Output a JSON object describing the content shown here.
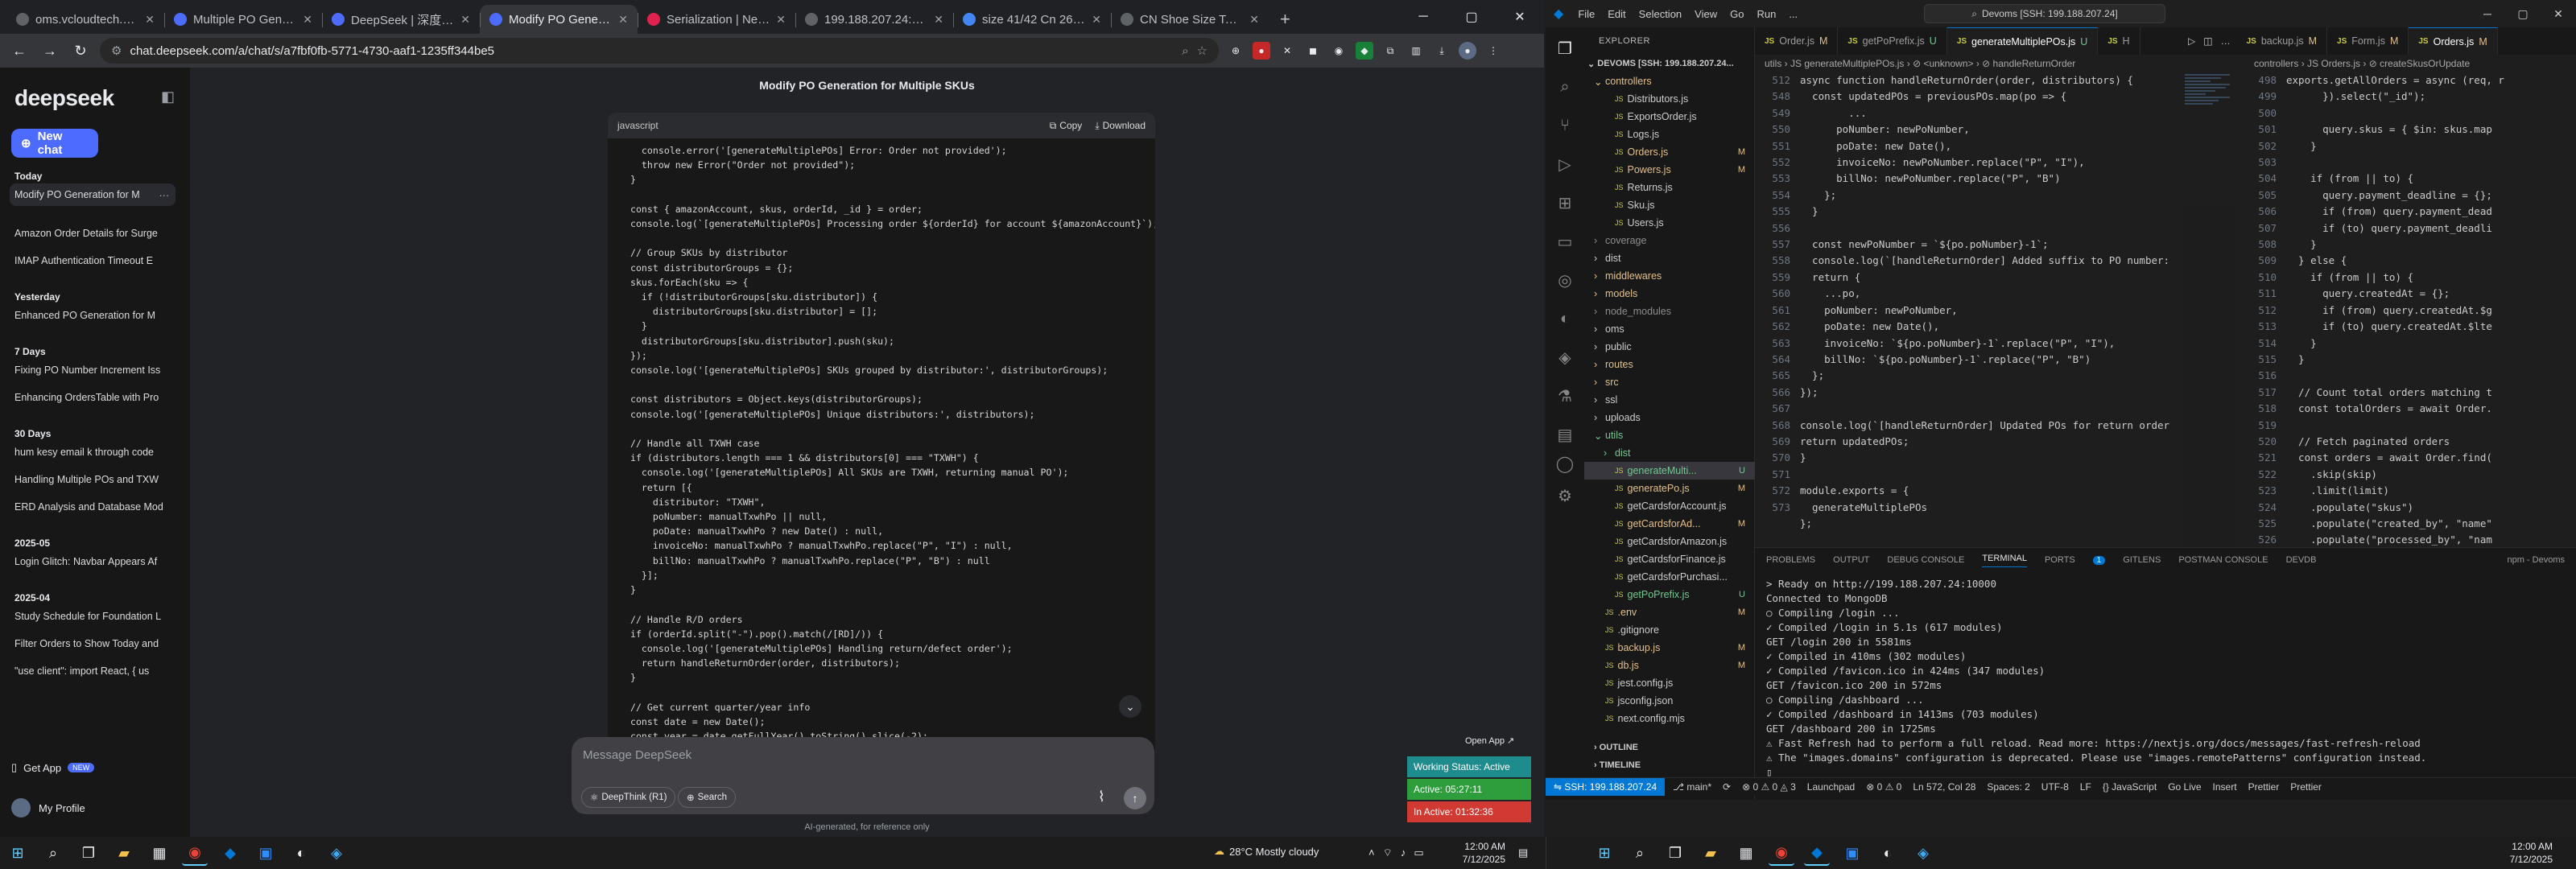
{
  "browser": {
    "tabs": [
      {
        "title": "oms.vcloudtech.org/das",
        "fav": "#5f6368"
      },
      {
        "title": "Multiple PO Generation",
        "fav": "#4d6bfe"
      },
      {
        "title": "DeepSeek | 深度求索",
        "fav": "#4d6bfe"
      },
      {
        "title": "Modify PO Generation fo",
        "fav": "#4d6bfe"
      },
      {
        "title": "Serialization | NestJS - A",
        "fav": "#e0234e"
      },
      {
        "title": "199.188.207.24:10000/da",
        "fav": "#5f6368"
      },
      {
        "title": "size 41/42 Cn 26.5 - Goo",
        "fav": "#4285f4"
      },
      {
        "title": "CN Shoe Size To US - A",
        "fav": "#5f6368"
      }
    ],
    "new_tab": "+",
    "url": "chat.deepseek.com/a/chat/s/a7fbf0fb-5771-4730-aaf1-1235ff344be5"
  },
  "deepseek": {
    "logo": "deepseek",
    "new_chat": "New chat",
    "groups": [
      {
        "label": "Today",
        "items": [
          "Modify PO Generation for M"
        ]
      },
      {
        "label": "",
        "items": [
          "Amazon Order Details for Surge",
          "IMAP Authentication Timeout E"
        ]
      },
      {
        "label": "Yesterday",
        "items": [
          "Enhanced PO Generation for M"
        ]
      },
      {
        "label": "7 Days",
        "items": [
          "Fixing PO Number Increment Iss",
          "Enhancing OrdersTable with Pro"
        ]
      },
      {
        "label": "30 Days",
        "items": [
          "hum kesy email k through code",
          "Handling Multiple POs and TXW",
          "ERD Analysis and Database Mod"
        ]
      },
      {
        "label": "2025-05",
        "items": [
          "Login Glitch: Navbar Appears Af"
        ]
      },
      {
        "label": "2025-04",
        "items": [
          "Study Schedule for Foundation L",
          "Filter Orders to Show Today and",
          "\"use client\": import React, { us"
        ]
      }
    ],
    "get_app": "Get App",
    "get_app_badge": "NEW",
    "profile": "My Profile",
    "chat_title": "Modify PO Generation for Multiple SKUs",
    "code_lang": "javascript",
    "copy": "Copy",
    "download": "Download",
    "code": "    console.error('[generateMultiplePOs] Error: Order not provided');\n    throw new Error(\"Order not provided\");\n  }\n\n  const { amazonAccount, skus, orderId, _id } = order;\n  console.log(`[generateMultiplePOs] Processing order ${orderId} for account ${amazonAccount}`);\n\n  // Group SKUs by distributor\n  const distributorGroups = {};\n  skus.forEach(sku => {\n    if (!distributorGroups[sku.distributor]) {\n      distributorGroups[sku.distributor] = [];\n    }\n    distributorGroups[sku.distributor].push(sku);\n  });\n  console.log('[generateMultiplePOs] SKUs grouped by distributor:', distributorGroups);\n\n  const distributors = Object.keys(distributorGroups);\n  console.log('[generateMultiplePOs] Unique distributors:', distributors);\n\n  // Handle all TXWH case\n  if (distributors.length === 1 && distributors[0] === \"TXWH\") {\n    console.log('[generateMultiplePOs] All SKUs are TXWH, returning manual PO');\n    return [{\n      distributor: \"TXWH\",\n      poNumber: manualTxwhPo || null,\n      poDate: manualTxwhPo ? new Date() : null,\n      invoiceNo: manualTxwhPo ? manualTxwhPo.replace(\"P\", \"I\") : null,\n      billNo: manualTxwhPo ? manualTxwhPo.replace(\"P\", \"B\") : null\n    }];\n  }\n\n  // Handle R/D orders\n  if (orderId.split(\"-\").pop().match(/[RD]/)) {\n    console.log('[generateMultiplePOs] Handling return/defect order');\n    return handleReturnOrder(order, distributors);\n  }\n\n  // Get current quarter/year info\n  const date = new Date();\n  const year = date.getFullYear().toString().slice(-2);",
    "input_placeholder": "Message DeepSeek",
    "deepthink": "DeepThink (R1)",
    "search": "Search",
    "footer": "AI-generated, for reference only",
    "open_app": "Open App ↗",
    "status_working": "Working Status: Active",
    "status_active": "Active: 05:27:11",
    "status_inactive": "In Active: 01:32:36",
    "colors": {
      "accent": "#4d6bfe",
      "status_teal": "#1e8c8c",
      "status_green": "#2e9e3c",
      "status_red": "#d13a32"
    }
  },
  "vscode": {
    "menu": [
      "File",
      "Edit",
      "Selection",
      "View",
      "Go",
      "Run",
      "..."
    ],
    "search": "Devoms [SSH: 199.188.207.24]",
    "explorer_title": "EXPLORER",
    "root": "DEVOMS [SSH: 199.188.207.24...",
    "tree": [
      {
        "name": "controllers",
        "depth": 1,
        "folder": true,
        "open": true,
        "badge": "",
        "color": "#e2c08d"
      },
      {
        "name": "Distributors.js",
        "depth": 2,
        "badge": "",
        "color": "#cccccc"
      },
      {
        "name": "ExportsOrder.js",
        "depth": 2,
        "badge": "",
        "color": "#cccccc"
      },
      {
        "name": "Logs.js",
        "depth": 2,
        "badge": "",
        "color": "#cccccc"
      },
      {
        "name": "Orders.js",
        "depth": 2,
        "badge": "M",
        "color": "#e2c08d"
      },
      {
        "name": "Powers.js",
        "depth": 2,
        "badge": "M",
        "color": "#e2c08d"
      },
      {
        "name": "Returns.js",
        "depth": 2,
        "badge": "",
        "color": "#cccccc"
      },
      {
        "name": "Sku.js",
        "depth": 2,
        "badge": "",
        "color": "#cccccc"
      },
      {
        "name": "Users.js",
        "depth": 2,
        "badge": "",
        "color": "#cccccc"
      },
      {
        "name": "coverage",
        "depth": 1,
        "folder": true,
        "badge": "",
        "color": "#8c8c8c"
      },
      {
        "name": "dist",
        "depth": 1,
        "folder": true,
        "badge": "",
        "color": "#cccccc"
      },
      {
        "name": "middlewares",
        "depth": 1,
        "folder": true,
        "badge": "",
        "color": "#e2c08d"
      },
      {
        "name": "models",
        "depth": 1,
        "folder": true,
        "badge": "",
        "color": "#e2c08d"
      },
      {
        "name": "node_modules",
        "depth": 1,
        "folder": true,
        "badge": "",
        "color": "#8c8c8c"
      },
      {
        "name": "oms",
        "depth": 1,
        "folder": true,
        "badge": "",
        "color": "#cccccc"
      },
      {
        "name": "public",
        "depth": 1,
        "folder": true,
        "badge": "",
        "color": "#cccccc"
      },
      {
        "name": "routes",
        "depth": 1,
        "folder": true,
        "badge": "",
        "color": "#e2c08d"
      },
      {
        "name": "src",
        "depth": 1,
        "folder": true,
        "badge": "",
        "color": "#e2c08d"
      },
      {
        "name": "ssl",
        "depth": 1,
        "folder": true,
        "badge": "",
        "color": "#cccccc"
      },
      {
        "name": "uploads",
        "depth": 1,
        "folder": true,
        "badge": "",
        "color": "#cccccc"
      },
      {
        "name": "utils",
        "depth": 1,
        "folder": true,
        "open": true,
        "badge": "",
        "color": "#73c991"
      },
      {
        "name": "dist",
        "depth": 2,
        "folder": true,
        "badge": "",
        "color": "#73c991"
      },
      {
        "name": "generateMulti...",
        "depth": 2,
        "badge": "U",
        "color": "#73c991",
        "sel": true
      },
      {
        "name": "generatePo.js",
        "depth": 2,
        "badge": "M",
        "color": "#e2c08d"
      },
      {
        "name": "getCardsforAccount.js",
        "depth": 2,
        "badge": "",
        "color": "#cccccc"
      },
      {
        "name": "getCardsforAd...",
        "depth": 2,
        "badge": "M",
        "color": "#e2c08d"
      },
      {
        "name": "getCardsforAmazon.js",
        "depth": 2,
        "badge": "",
        "color": "#cccccc"
      },
      {
        "name": "getCardsforFinance.js",
        "depth": 2,
        "badge": "",
        "color": "#cccccc"
      },
      {
        "name": "getCardsforPurchasi...",
        "depth": 2,
        "badge": "",
        "color": "#cccccc"
      },
      {
        "name": "getPoPrefix.js",
        "depth": 2,
        "badge": "U",
        "color": "#73c991"
      },
      {
        "name": ".env",
        "depth": 1,
        "badge": "M",
        "color": "#e2c08d"
      },
      {
        "name": ".gitignore",
        "depth": 1,
        "badge": "",
        "color": "#cccccc"
      },
      {
        "name": "backup.js",
        "depth": 1,
        "badge": "M",
        "color": "#e2c08d"
      },
      {
        "name": "db.js",
        "depth": 1,
        "badge": "M",
        "color": "#e2c08d"
      },
      {
        "name": "jest.config.js",
        "depth": 1,
        "badge": "",
        "color": "#cccccc"
      },
      {
        "name": "jsconfig.json",
        "depth": 1,
        "badge": "",
        "color": "#cccccc"
      },
      {
        "name": "next.config.mjs",
        "depth": 1,
        "badge": "",
        "color": "#cccccc"
      }
    ],
    "outline": "OUTLINE",
    "timeline": "TIMELINE",
    "left_tabs": [
      {
        "name": "Order.js",
        "badge": "M",
        "on": false
      },
      {
        "name": "getPoPrefix.js",
        "badge": "U",
        "on": false
      },
      {
        "name": "generateMultiplePOs.js",
        "badge": "U",
        "on": true
      },
      {
        "name": "H",
        "badge": "",
        "on": false
      }
    ],
    "right_tabs": [
      {
        "name": "backup.js",
        "badge": "M",
        "on": false
      },
      {
        "name": "Form.js",
        "badge": "M",
        "on": false
      },
      {
        "name": "Orders.js",
        "badge": "M",
        "on": true
      }
    ],
    "left_breadcrumb": "utils › JS generateMultiplePOs.js › ⊘ <unknown> › ⊘ handleReturnOrder",
    "right_breadcrumb": "controllers › JS Orders.js › ⊘ createSkusOrUpdate",
    "left_lines": "512\n548\n549\n550\n551\n552\n553\n554\n555\n556\n557\n558\n559\n560\n561\n562\n563\n564\n565\n566\n567\n568\n569\n570\n571\n572\n573",
    "left_code": "async function handleReturnOrder(order, distributors) {\n  const updatedPOs = previousPOs.map(po => {\n        ...\n      poNumber: newPoNumber,\n      poDate: new Date(),\n      invoiceNo: newPoNumber.replace(\"P\", \"I\"),\n      billNo: newPoNumber.replace(\"P\", \"B\")\n    };\n  }\n\n  const newPoNumber = `${po.poNumber}-1`;\n  console.log(`[handleReturnOrder] Added suffix to PO number: ${ne\n  return {\n    ...po,\n    poNumber: newPoNumber,\n    poDate: new Date(),\n    invoiceNo: `${po.poNumber}-1`.replace(\"P\", \"I\"),\n    billNo: `${po.poNumber}-1`.replace(\"P\", \"B\")\n  };\n});\n\nconsole.log(`[handleReturnOrder] Updated POs for return order ${\nreturn updatedPOs;\n}\n\nmodule.exports = {\n  generateMultiplePOs\n};",
    "right_lines": "498\n499\n500\n501\n502\n503\n504\n505\n506\n507\n508\n509\n510\n511\n512\n513\n514\n515\n516\n517\n518\n519\n520\n521\n522\n523\n524\n525\n526",
    "right_code": "exports.getAllOrders = async (req, r\n      }).select(\"_id\");\n\n      query.skus = { $in: skus.map\n    }\n\n    if (from || to) {\n      query.payment_deadline = {};\n      if (from) query.payment_dead\n      if (to) query.payment_deadli\n    }\n  } else {\n    if (from || to) {\n      query.createdAt = {};\n      if (from) query.createdAt.$g\n      if (to) query.createdAt.$lte\n    }\n  }\n\n  // Count total orders matching t\n  const totalOrders = await Order.\n\n  // Fetch paginated orders\n  const orders = await Order.find(\n    .skip(skip)\n    .limit(limit)\n    .populate(\"skus\")\n    .populate(\"created_by\", \"name\"\n    .populate(\"processed_by\", \"nam\n    .populate(\"verified_by\", \"name",
    "panel_tabs": [
      "PROBLEMS",
      "OUTPUT",
      "DEBUG CONSOLE",
      "TERMINAL",
      "PORTS",
      "GITLENS",
      "POSTMAN CONSOLE",
      "DEVDB"
    ],
    "ports_badge": "1",
    "terminal_name": "npm - Devoms",
    "terminal": "> Ready on http://199.188.207.24:10000\nConnected to MongoDB\n○ Compiling /login ...\n✓ Compiled /login in 5.1s (617 modules)\nGET /login 200 in 5581ms\n✓ Compiled in 410ms (302 modules)\n✓ Compiled /favicon.ico in 424ms (347 modules)\nGET /favicon.ico 200 in 572ms\n○ Compiling /dashboard ...\n✓ Compiled /dashboard in 1413ms (703 modules)\nGET /dashboard 200 in 1725ms\n⚠ Fast Refresh had to perform a full reload. Read more: https://nextjs.org/docs/messages/fast-refresh-reload\n⚠ The \"images.domains\" configuration is deprecated. Please use \"images.remotePatterns\" configuration instead.\n▯",
    "status_remote": "SSH: 199.188.207.24",
    "status_items": [
      "⎇ main*",
      "⟳",
      "⊗ 0 ⚠ 0 ◬ 3",
      "Launchpad",
      "⊗ 0 ⚠ 0",
      "Ln 572, Col 28",
      "Spaces: 2",
      "UTF-8",
      "LF",
      "{} JavaScript",
      "Go Live",
      "Insert",
      "Prettier",
      "Prettier"
    ]
  },
  "taskbar": {
    "left_time": "12:00 AM",
    "left_date": "7/12/2025",
    "weather": "28°C  Mostly cloudy",
    "right_time": "12:00 AM",
    "right_date": "7/12/2025"
  }
}
